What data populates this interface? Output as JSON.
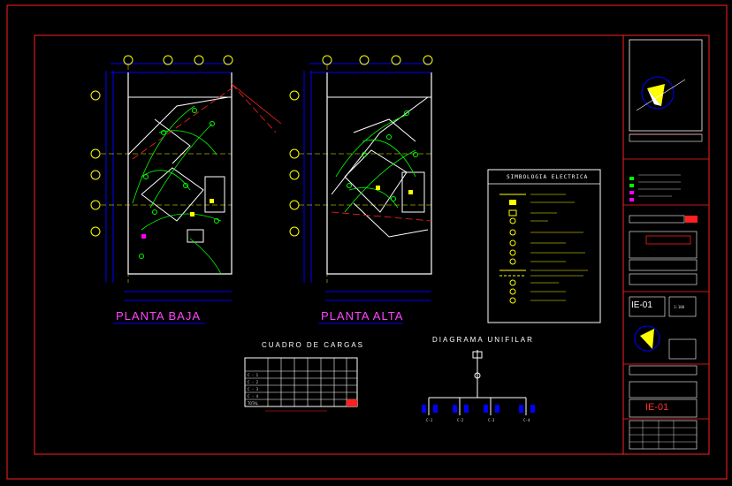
{
  "plans": {
    "ground_floor_title": "PLANTA BAJA",
    "upper_floor_title": "PLANTA ALTA"
  },
  "load_table": {
    "title": "CUADRO DE CARGAS",
    "rows": [
      "C - 1",
      "C - 2",
      "C - 3",
      "C - 4",
      "TOTAL"
    ]
  },
  "single_line": {
    "title": "DIAGRAMA UNIFILAR",
    "circuits": [
      "C-1",
      "C-2",
      "C-3",
      "C-4"
    ]
  },
  "legend": {
    "title": "SIMBOLOGIA ELECTRICA"
  },
  "title_block": {
    "sheet_code": "IE-01",
    "sheet_code_large": "IE-01",
    "scale": "1:100"
  },
  "colors": {
    "frame": "#ff2020",
    "walls": "#ffffff",
    "wiring": "#00ff00",
    "grid": "#ffff00",
    "dims": "#0000ff",
    "title_accent": "#ff44ff"
  }
}
